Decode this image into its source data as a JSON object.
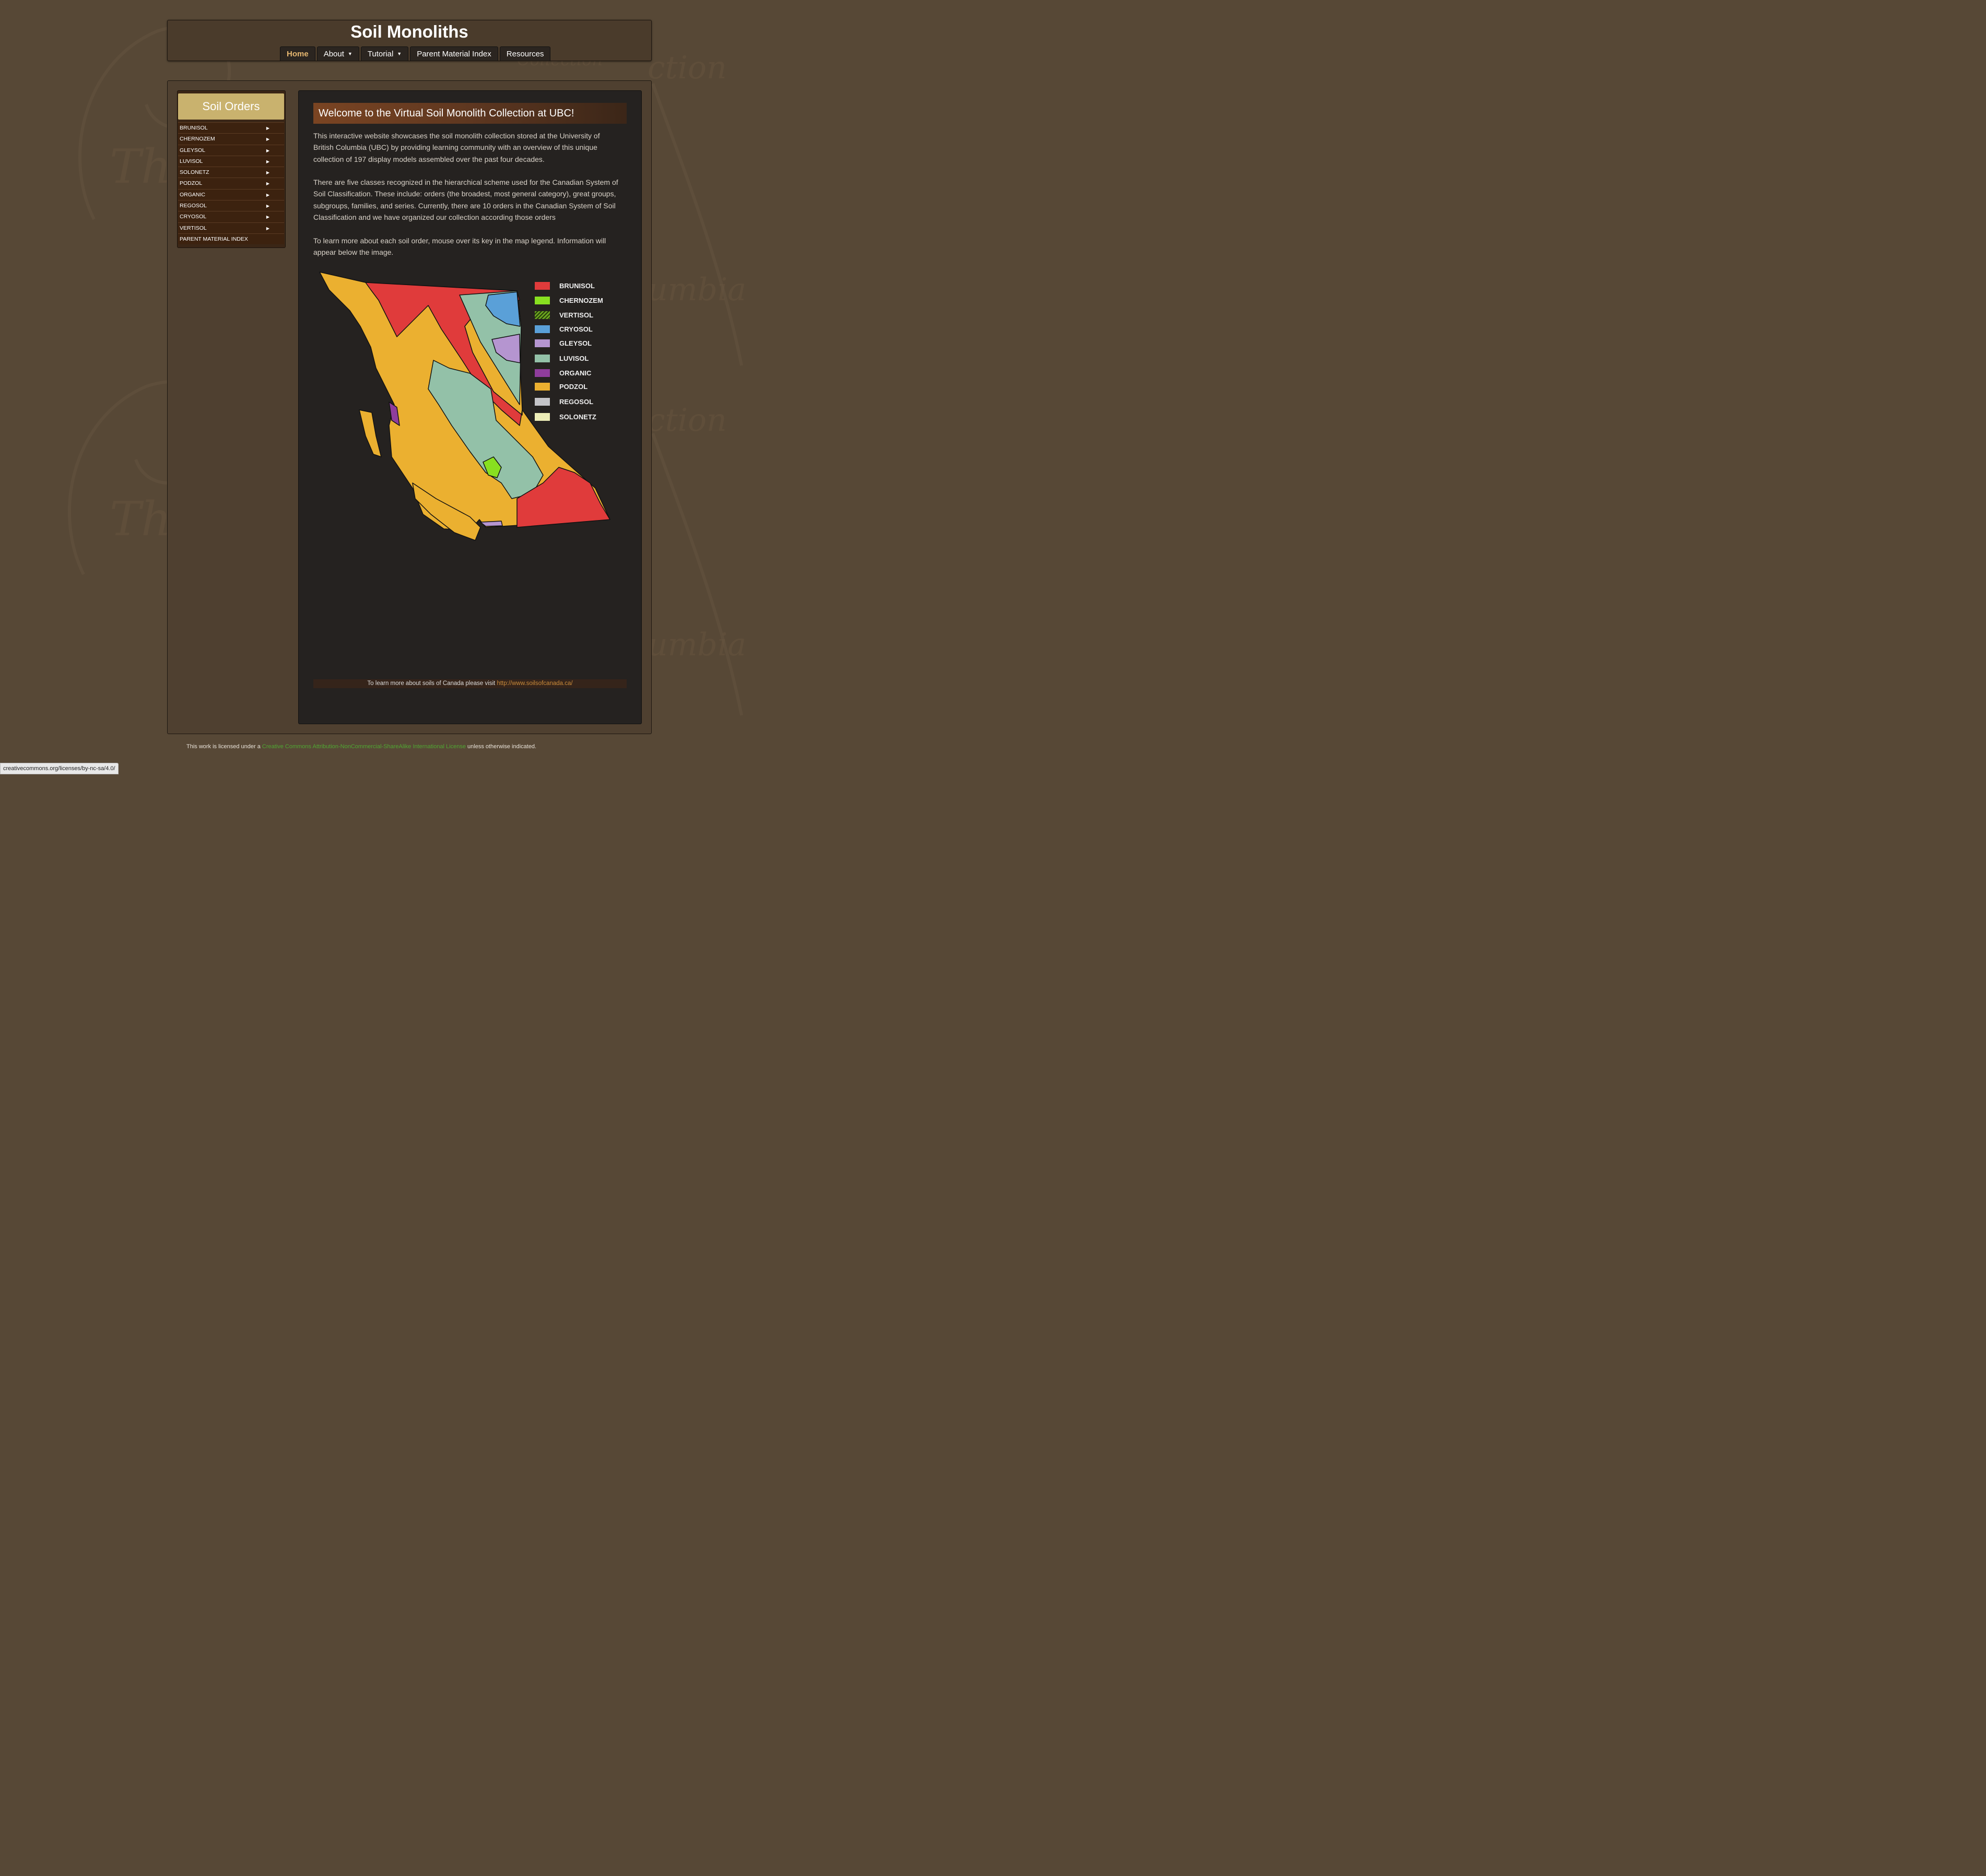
{
  "site": {
    "title": "Soil Monoliths"
  },
  "nav": [
    {
      "label": "Home",
      "active": true,
      "dropdown": false
    },
    {
      "label": "About",
      "active": false,
      "dropdown": true
    },
    {
      "label": "Tutorial",
      "active": false,
      "dropdown": true
    },
    {
      "label": "Parent Material Index",
      "active": false,
      "dropdown": false
    },
    {
      "label": "Resources",
      "active": false,
      "dropdown": false
    }
  ],
  "sidebar": {
    "title": "Soil Orders",
    "items": [
      {
        "label": "BRUNISOL"
      },
      {
        "label": "CHERNOZEM"
      },
      {
        "label": "GLEYSOL"
      },
      {
        "label": "LUVISOL"
      },
      {
        "label": "SOLONETZ"
      },
      {
        "label": "PODZOL"
      },
      {
        "label": "ORGANIC"
      },
      {
        "label": "REGOSOL"
      },
      {
        "label": "CRYOSOL"
      },
      {
        "label": "VERTISOL"
      },
      {
        "label": "PARENT MATERIAL INDEX"
      }
    ]
  },
  "main": {
    "heading": "Welcome to the Virtual Soil Monolith Collection at UBC!",
    "paragraphs": [
      "This interactive website showcases the soil monolith collection stored at the University of British Columbia (UBC) by providing learning community with an overview of this unique collection of 197 display models assembled over the past four decades.",
      "There are five classes recognized in the hierarchical scheme used for the Canadian System of Soil Classification. These include: orders (the broadest, most general category), great groups, subgroups, families, and series. Currently, there are 10 orders in the Canadian System of Soil Classification and we have organized our collection according those orders",
      "To learn more about each soil order, mouse over its key in the map legend. Information will appear below the image."
    ],
    "footer_text": "To learn more about soils of Canada please visit",
    "footer_link": "http://www.soilsofcanada.ca/"
  },
  "legend": [
    {
      "label": "BRUNISOL",
      "color": "#e03b3b"
    },
    {
      "label": "CHERNOZEM",
      "color": "#88e020"
    },
    {
      "label": "VERTISOL",
      "color": "#6aa51e",
      "hatched": true
    },
    {
      "label": "CRYOSOL",
      "color": "#5aa0d8"
    },
    {
      "label": "GLEYSOL",
      "color": "#b595d0"
    },
    {
      "label": "LUVISOL",
      "color": "#93c1a8"
    },
    {
      "label": "ORGANIC",
      "color": "#8f3d9c"
    },
    {
      "label": "PODZOL",
      "color": "#ebb030"
    },
    {
      "label": "REGOSOL",
      "color": "#c4c4c8"
    },
    {
      "label": "SOLONETZ",
      "color": "#eeeeb8"
    }
  ],
  "license": {
    "prefix": "This work is licensed under a",
    "link": "Creative Commons Attribution-NonCommercial-ShareAlike International License",
    "suffix": "unless otherwise indicated."
  },
  "status_url": "creativecommons.org/licenses/by-nc-sa/4.0/"
}
